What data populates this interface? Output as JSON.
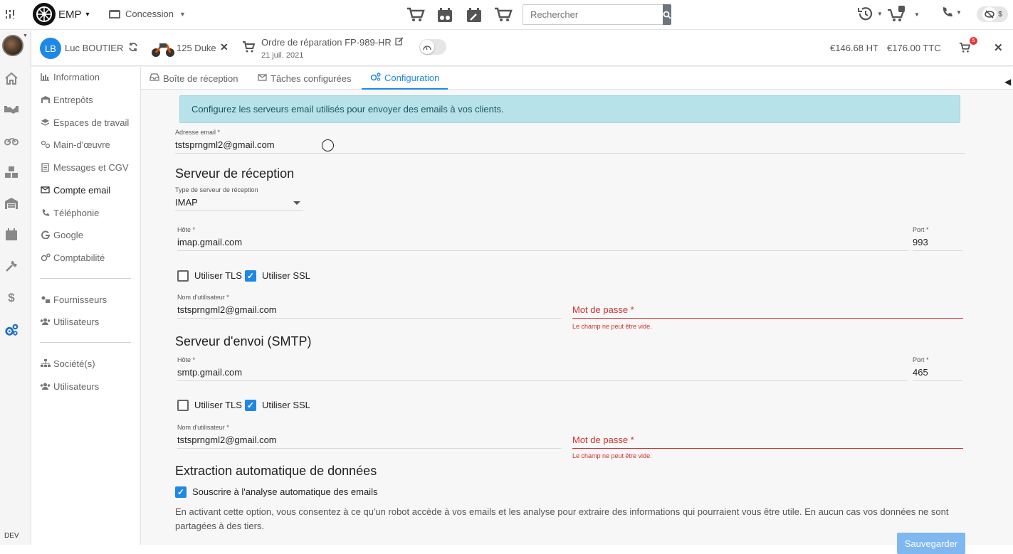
{
  "topbar": {
    "app_name": "EMP",
    "concession_label": "Concession",
    "search_placeholder": "Rechercher"
  },
  "context": {
    "initials": "LB",
    "customer_name": "Luc BOUTIER",
    "vehicle": "125 Duke",
    "order_title": "Ordre de réparation FP-989-HR",
    "order_date": "21 juil. 2021",
    "amount_ht": "€146.68 HT",
    "amount_ttc": "€176.00 TTC",
    "cart_badge": "5"
  },
  "sidebar": {
    "dev_label": "DEV"
  },
  "settings_nav": {
    "items": [
      {
        "label": "Information",
        "icon": "chart-icon"
      },
      {
        "label": "Entrepôts",
        "icon": "warehouse-icon"
      },
      {
        "label": "Espaces de travail",
        "icon": "layers-icon"
      },
      {
        "label": "Main-d'œuvre",
        "icon": "labor-icon"
      },
      {
        "label": "Messages et CGV",
        "icon": "document-icon"
      },
      {
        "label": "Compte email",
        "icon": "envelope-icon"
      },
      {
        "label": "Téléphonie",
        "icon": "phone-icon"
      },
      {
        "label": "Google",
        "icon": "google-icon"
      },
      {
        "label": "Comptabilité",
        "icon": "cogs-icon"
      },
      {
        "label": "Fournisseurs",
        "icon": "suppliers-icon"
      },
      {
        "label": "Utilisateurs",
        "icon": "users-icon"
      },
      {
        "label": "Société(s)",
        "icon": "org-icon"
      },
      {
        "label": "Utilisateurs",
        "icon": "users-icon"
      }
    ]
  },
  "tabs": [
    {
      "label": "Boîte de réception"
    },
    {
      "label": "Tâches configurées"
    },
    {
      "label": "Configuration"
    }
  ],
  "form": {
    "banner": "Configurez les serveurs email utilisés pour envoyer des emails à vos clients.",
    "email_label": "Adresse email *",
    "email_value": "tstsprngml2@gmail.com",
    "incoming": {
      "title": "Serveur de réception",
      "type_label": "Type de serveur de réception",
      "type_value": "IMAP",
      "host_label": "Hôte *",
      "host_value": "imap.gmail.com",
      "port_label": "Port *",
      "port_value": "993",
      "tls_label": "Utiliser TLS",
      "ssl_label": "Utiliser SSL",
      "user_label": "Nom d'utilisateur *",
      "user_value": "tstsprngml2@gmail.com",
      "password_label": "Mot de passe *",
      "password_error": "Le champ ne peut être vide."
    },
    "outgoing": {
      "title": "Serveur d'envoi (SMTP)",
      "host_label": "Hôte *",
      "host_value": "smtp.gmail.com",
      "port_label": "Port *",
      "port_value": "465",
      "tls_label": "Utiliser TLS",
      "ssl_label": "Utiliser SSL",
      "user_label": "Nom d'utilisateur *",
      "user_value": "tstsprngml2@gmail.com",
      "password_label": "Mot de passe *",
      "password_error": "Le champ ne peut être vide."
    },
    "extraction": {
      "title": "Extraction automatique de données",
      "subscribe_label": "Souscrire à l'analyse automatique des emails",
      "description": "En activant cette option, vous consentez à ce qu'un robot accède à vos emails et les analyse pour extraire des informations qui pourraient vous être utile. En aucun cas vos données ne sont partagées à des tiers."
    },
    "save_label": "Sauvegarder"
  },
  "colors": {
    "primary": "#1e88e5",
    "error": "#d32f2f",
    "banner_bg": "#b8e2ea"
  }
}
